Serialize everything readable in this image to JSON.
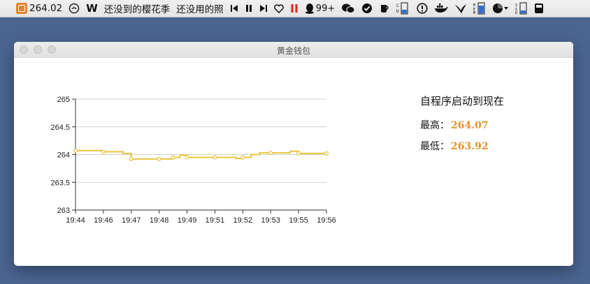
{
  "menubar": {
    "price": "264.02",
    "w_label": "W",
    "song": "还没到的樱花季",
    "song_artist": "还没用的照",
    "qq_badge": "99+"
  },
  "window": {
    "title": "黄金钱包"
  },
  "stats": {
    "heading": "自程序启动到现在",
    "high_label": "最高：",
    "high_value": "264.07",
    "low_label": "最低：",
    "low_value": "263.92"
  },
  "chart_data": {
    "type": "line",
    "x_ticks": [
      "19:44",
      "19:46",
      "19:47",
      "19:48",
      "19:49",
      "19:51",
      "19:52",
      "19:53",
      "19:55",
      "19:56"
    ],
    "y_ticks": [
      "265",
      "264.5",
      "264",
      "263.5",
      "263"
    ],
    "ylim": [
      263,
      265
    ],
    "xlim": [
      0,
      9
    ],
    "grid": true,
    "line_color": "#e8c640",
    "series": [
      {
        "x": [
          0,
          0.35,
          1.0,
          1.45,
          1.7,
          2.0,
          2.5,
          3.0,
          3.5,
          3.75,
          4.0,
          4.5,
          5.0,
          5.5,
          5.75,
          6.0,
          6.3,
          6.6,
          7.0,
          7.5,
          7.7,
          8.0,
          8.4,
          9.0
        ],
        "y": [
          264.07,
          264.07,
          264.05,
          264.05,
          264.02,
          263.92,
          263.92,
          263.92,
          263.95,
          263.99,
          263.95,
          263.95,
          263.95,
          263.95,
          263.93,
          263.95,
          264.0,
          264.03,
          264.03,
          264.03,
          264.06,
          264.02,
          264.02,
          264.02
        ],
        "markers": [
          0,
          2,
          5,
          7,
          8,
          10,
          12,
          15,
          18,
          21,
          23
        ]
      }
    ]
  }
}
